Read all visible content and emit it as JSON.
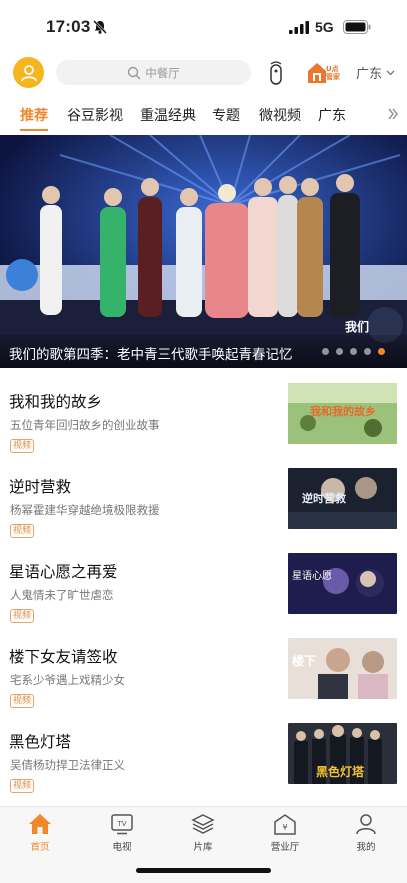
{
  "status_bar": {
    "time": "17:03",
    "network": "5G"
  },
  "header": {
    "search_placeholder": "中餐厅",
    "udian_text": "U点管家",
    "region": "广东"
  },
  "tabs": [
    {
      "label": "推荐",
      "active": true
    },
    {
      "label": "谷豆影视",
      "active": false
    },
    {
      "label": "重温经典",
      "active": false
    },
    {
      "label": "专题",
      "active": false
    },
    {
      "label": "微视频",
      "active": false
    },
    {
      "label": "广东",
      "active": false
    }
  ],
  "banner": {
    "title": "我们的歌第四季：老中青三代歌手唤起青春记忆",
    "dot_count": 5,
    "active_dot": 4,
    "stage_logo": "我们"
  },
  "items": [
    {
      "title": "我和我的故乡",
      "desc": "五位青年回归故乡的创业故事",
      "tag": "视频",
      "thumb_text": "我和我的故乡"
    },
    {
      "title": "逆时营救",
      "desc": "杨幂霍建华穿越绝境极限救援",
      "tag": "视频",
      "thumb_text": "逆时营救"
    },
    {
      "title": "星语心愿之再爱",
      "desc": "人鬼情未了旷世虐恋",
      "tag": "视频",
      "thumb_text": "星语心愿"
    },
    {
      "title": "楼下女友请签收",
      "desc": "宅系少爷遇上戏精少女",
      "tag": "视频",
      "thumb_text": "楼下"
    },
    {
      "title": "黑色灯塔",
      "desc": "吴倩杨玏捍卫法律正义",
      "tag": "视频",
      "thumb_text": "黑色灯塔"
    }
  ],
  "bottom_nav": [
    {
      "label": "首页",
      "icon": "home-icon",
      "active": true
    },
    {
      "label": "电视",
      "icon": "tv-icon",
      "active": false
    },
    {
      "label": "片库",
      "icon": "layers-icon",
      "active": false
    },
    {
      "label": "营业厅",
      "icon": "store-icon",
      "active": false
    },
    {
      "label": "我的",
      "icon": "person-icon",
      "active": false
    }
  ],
  "colors": {
    "accent": "#f0882a",
    "avatar": "#f7b51d",
    "banner_bg": "#0f1746"
  }
}
